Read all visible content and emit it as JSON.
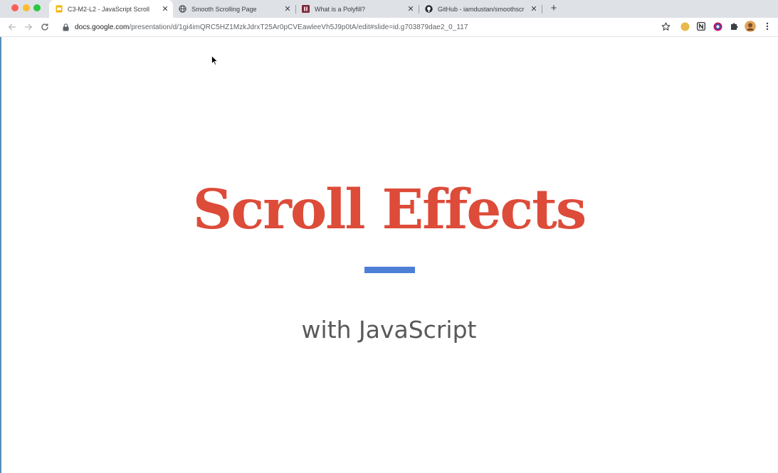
{
  "browser": {
    "tabs": [
      {
        "title": "C3-M2-L2 - JavaScript Scroll",
        "icon": "google-slides-icon",
        "active": true
      },
      {
        "title": "Smooth Scrolling Page",
        "icon": "globe-icon",
        "active": false
      },
      {
        "title": "What is a Polyfill?",
        "icon": "site-favicon-icon",
        "active": false
      },
      {
        "title": "GitHub - iamdustan/smoothscr",
        "icon": "github-icon",
        "active": false
      }
    ],
    "close_glyph": "✕",
    "new_tab_glyph": "+",
    "address_bar": {
      "host": "docs.google.com",
      "path": "/presentation/d/1gi4imQRC5HZ1MzkJdrxT25Ar0pCVEawleeVh5J9p0tA/edit#slide=id.g703879dae2_0_117"
    },
    "extensions": [
      "yellow-extension-icon",
      "notion-icon",
      "color-picker-icon",
      "puzzle-icon",
      "profile-avatar",
      "kebab-menu-icon"
    ]
  },
  "slide": {
    "title": "Scroll Effects",
    "subtitle": "with JavaScript",
    "title_color": "#dd4b39",
    "rule_color": "#4d7fd6",
    "subtitle_color": "#595959"
  }
}
